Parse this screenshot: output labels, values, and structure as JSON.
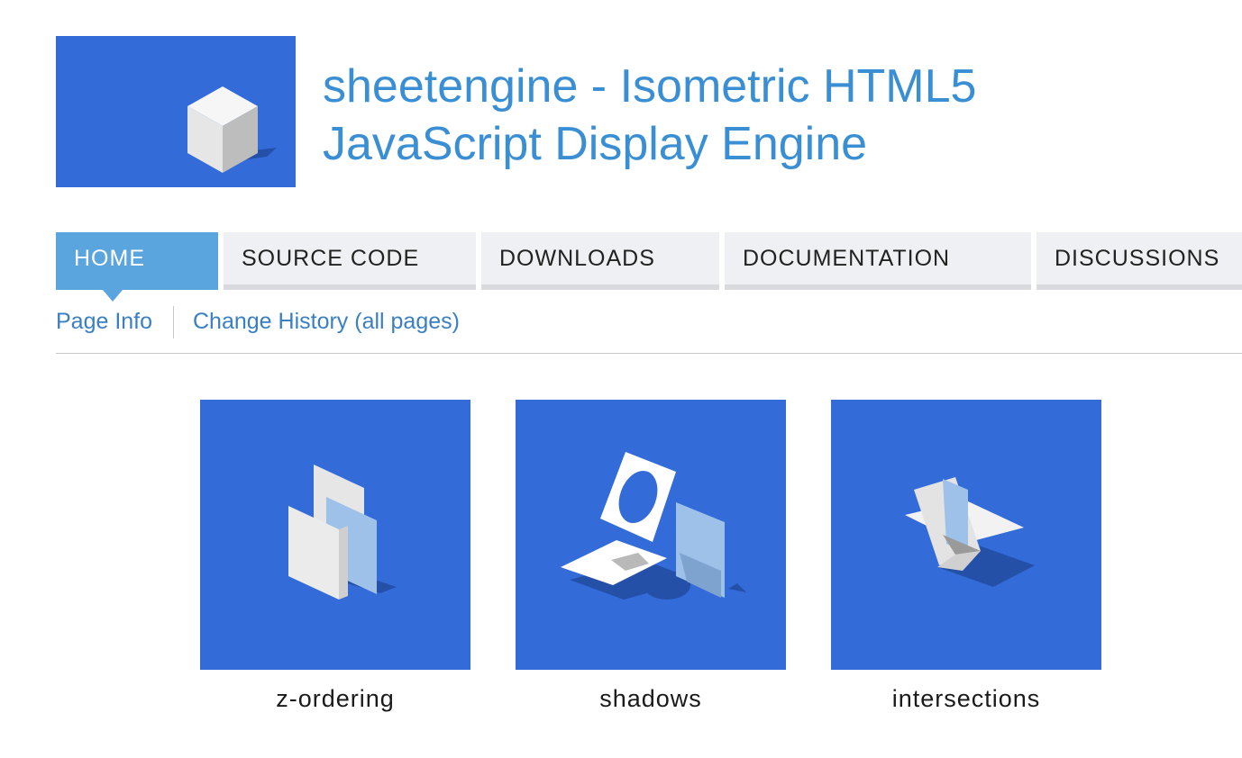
{
  "header": {
    "title_line1": "sheetengine - Isometric HTML5",
    "title_line2": "JavaScript Display Engine"
  },
  "tabs": [
    {
      "label": "HOME",
      "active": true
    },
    {
      "label": "SOURCE CODE",
      "active": false
    },
    {
      "label": "DOWNLOADS",
      "active": false
    },
    {
      "label": "DOCUMENTATION",
      "active": false
    },
    {
      "label": "DISCUSSIONS",
      "active": false
    }
  ],
  "subnav": {
    "page_info": "Page Info",
    "change_history": "Change History (all pages)"
  },
  "features": [
    {
      "caption": "z-ordering"
    },
    {
      "caption": "shadows"
    },
    {
      "caption": "intersections"
    }
  ],
  "colors": {
    "brand_blue": "#336bd9",
    "title_blue": "#3a8fd4",
    "tab_active": "#5aa5dd",
    "tab_bg": "#eff0f3",
    "link_blue": "#3a7fc4"
  }
}
